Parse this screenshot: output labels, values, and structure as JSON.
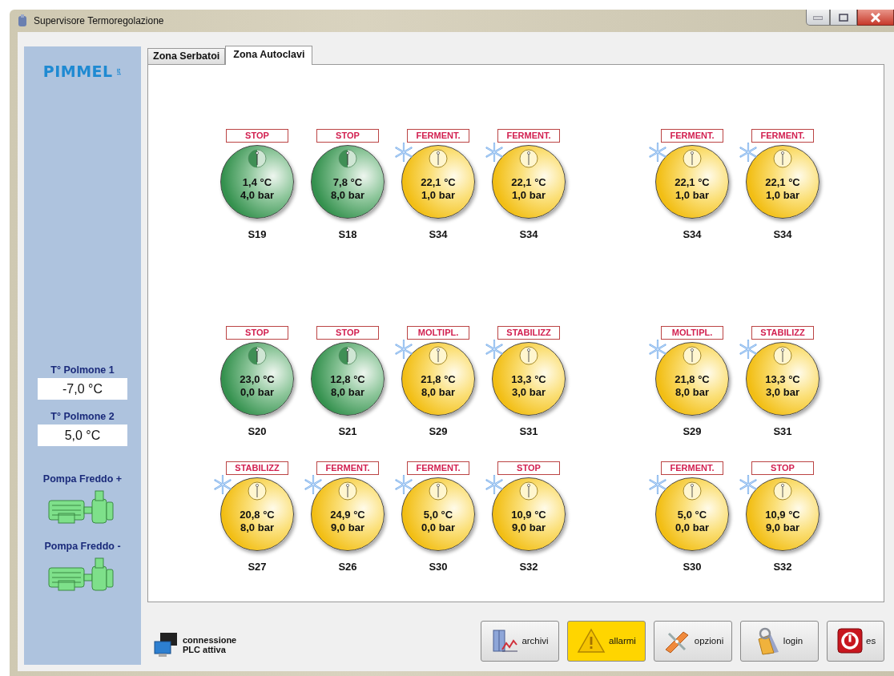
{
  "window": {
    "title": "Supervisore Termoregolazione"
  },
  "logo": {
    "name": "PIMMEL",
    "suffix": "srl"
  },
  "sidebar": {
    "readings": [
      {
        "label": "T° Polmone 1",
        "value": "-7,0 °C"
      },
      {
        "label": "T° Polmone 2",
        "value": "5,0 °C"
      }
    ],
    "pumps": [
      {
        "label": "Pompa Freddo +"
      },
      {
        "label": "Pompa Freddo -"
      }
    ]
  },
  "tabs": [
    {
      "label": "Zona Serbatoi",
      "selected": false
    },
    {
      "label": "Zona Autoclavi",
      "selected": true
    }
  ],
  "tank_rows": [
    {
      "left": [
        {
          "status": "STOP",
          "kind": "idle",
          "cooling": false,
          "temperature": "1,4 °C",
          "pressure": "4,0 bar",
          "name": "S19"
        },
        {
          "status": "STOP",
          "kind": "idle",
          "cooling": false,
          "temperature": "7,8 °C",
          "pressure": "8,0 bar",
          "name": "S18"
        },
        {
          "status": "FERMENT.",
          "kind": "active",
          "cooling": true,
          "temperature": "22,1 °C",
          "pressure": "1,0 bar",
          "name": "S34"
        },
        {
          "status": "FERMENT.",
          "kind": "active",
          "cooling": true,
          "temperature": "22,1 °C",
          "pressure": "1,0 bar",
          "name": "S34"
        }
      ],
      "right": [
        {
          "status": "FERMENT.",
          "kind": "active",
          "cooling": true,
          "temperature": "22,1 °C",
          "pressure": "1,0 bar",
          "name": "S34"
        },
        {
          "status": "FERMENT.",
          "kind": "active",
          "cooling": true,
          "temperature": "22,1 °C",
          "pressure": "1,0 bar",
          "name": "S34"
        }
      ]
    },
    {
      "left": [
        {
          "status": "STOP",
          "kind": "idle",
          "cooling": false,
          "temperature": "23,0 °C",
          "pressure": "0,0 bar",
          "name": "S20"
        },
        {
          "status": "STOP",
          "kind": "idle",
          "cooling": false,
          "temperature": "12,8 °C",
          "pressure": "8,0 bar",
          "name": "S21"
        },
        {
          "status": "MOLTIPL.",
          "kind": "active",
          "cooling": true,
          "temperature": "21,8 °C",
          "pressure": "8,0 bar",
          "name": "S29"
        },
        {
          "status": "STABILIZZ",
          "kind": "active",
          "cooling": true,
          "temperature": "13,3 °C",
          "pressure": "3,0 bar",
          "name": "S31"
        }
      ],
      "right": [
        {
          "status": "MOLTIPL.",
          "kind": "active",
          "cooling": true,
          "temperature": "21,8 °C",
          "pressure": "8,0 bar",
          "name": "S29"
        },
        {
          "status": "STABILIZZ",
          "kind": "active",
          "cooling": true,
          "temperature": "13,3 °C",
          "pressure": "3,0 bar",
          "name": "S31"
        }
      ]
    },
    {
      "left": [
        {
          "status": "STABILIZZ",
          "kind": "active",
          "cooling": true,
          "temperature": "20,8 °C",
          "pressure": "8,0 bar",
          "name": "S27"
        },
        {
          "status": "FERMENT.",
          "kind": "active",
          "cooling": true,
          "temperature": "24,9 °C",
          "pressure": "9,0 bar",
          "name": "S26"
        },
        {
          "status": "FERMENT.",
          "kind": "active",
          "cooling": true,
          "temperature": "5,0 °C",
          "pressure": "0,0 bar",
          "name": "S30"
        },
        {
          "status": "STOP",
          "kind": "active",
          "cooling": true,
          "temperature": "10,9 °C",
          "pressure": "9,0 bar",
          "name": "S32"
        }
      ],
      "right": [
        {
          "status": "FERMENT.",
          "kind": "active",
          "cooling": true,
          "temperature": "5,0 °C",
          "pressure": "0,0 bar",
          "name": "S30"
        },
        {
          "status": "STOP",
          "kind": "active",
          "cooling": true,
          "temperature": "10,9 °C",
          "pressure": "9,0 bar",
          "name": "S32"
        }
      ]
    }
  ],
  "connection": {
    "text": "connessione PLC attiva"
  },
  "buttons": [
    {
      "label": "archivi",
      "highlighted": false
    },
    {
      "label": "allarmi",
      "highlighted": true
    },
    {
      "label": "opzioni",
      "highlighted": false
    },
    {
      "label": "login",
      "highlighted": false
    },
    {
      "label": "es",
      "highlighted": false
    }
  ]
}
